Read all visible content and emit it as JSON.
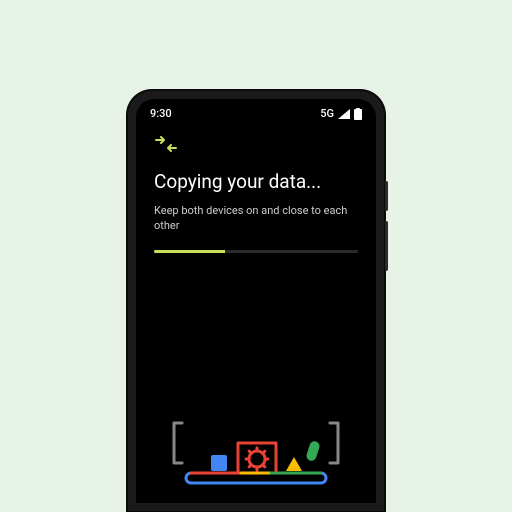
{
  "status_bar": {
    "time": "9:30",
    "network": "5G"
  },
  "content": {
    "title": "Copying your data...",
    "subtitle": "Keep both devices on and close to each other",
    "progress_percent": 35
  },
  "colors": {
    "accent": "#c6e05a",
    "background": "#e8f3e8",
    "screen": "#000000"
  }
}
